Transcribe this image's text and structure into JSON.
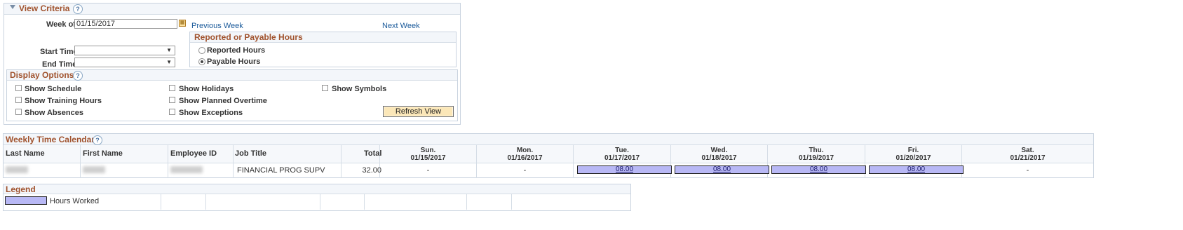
{
  "view_criteria": {
    "title": "View Criteria",
    "week_of_label": "Week of",
    "week_of_value": "01/15/2017",
    "previous_week": "Previous Week",
    "next_week": "Next Week",
    "start_time_label": "Start Time",
    "end_time_label": "End Time",
    "reported_group": {
      "title": "Reported or Payable Hours",
      "options": [
        "Reported Hours",
        "Payable Hours"
      ],
      "selected": "Payable Hours"
    },
    "display_options": {
      "title": "Display Options",
      "checkboxes": [
        "Show Schedule",
        "Show Holidays",
        "Show Symbols",
        "Show Training Hours",
        "Show Planned Overtime",
        "Show Absences",
        "Show Exceptions"
      ],
      "refresh_button": "Refresh View"
    }
  },
  "calendar": {
    "title": "Weekly Time Calendar",
    "columns": [
      "Last Name",
      "First Name",
      "Employee ID",
      "Job Title",
      "Total"
    ],
    "days": [
      {
        "name": "Sun.",
        "date": "01/15/2017"
      },
      {
        "name": "Mon.",
        "date": "01/16/2017"
      },
      {
        "name": "Tue.",
        "date": "01/17/2017"
      },
      {
        "name": "Wed.",
        "date": "01/18/2017"
      },
      {
        "name": "Thu.",
        "date": "01/19/2017"
      },
      {
        "name": "Fri.",
        "date": "01/20/2017"
      },
      {
        "name": "Sat.",
        "date": "01/21/2017"
      }
    ],
    "row": {
      "job_title": "FINANCIAL PROG SUPV",
      "total": "32.00",
      "day_values": [
        "-",
        "-",
        "08.00",
        "08.00",
        "08.00",
        "08.00",
        "-"
      ]
    }
  },
  "legend": {
    "title": "Legend",
    "hours_worked": "Hours Worked",
    "hours_color": "#b8b8f5"
  },
  "colors": {
    "section_title": "#a0522d",
    "link": "#1a5a9a",
    "button_bg": "#fbe7b8"
  }
}
